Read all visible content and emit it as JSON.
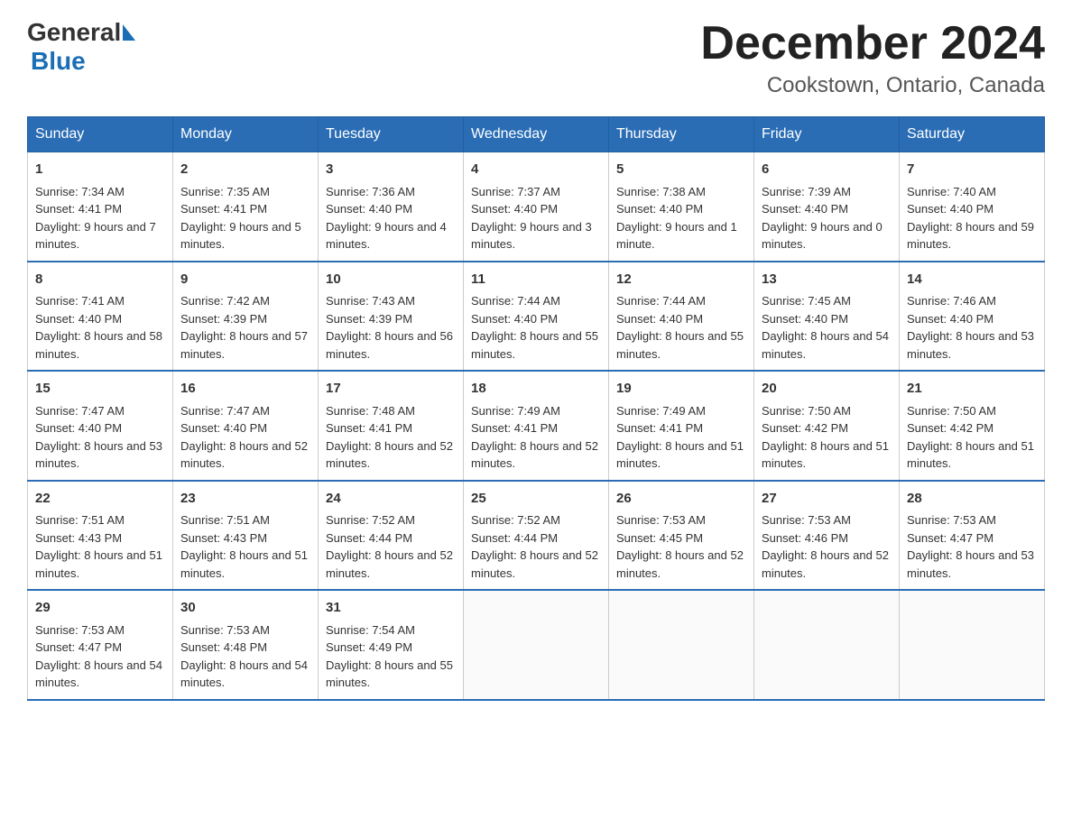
{
  "header": {
    "logo": {
      "text_general": "General",
      "text_blue": "Blue"
    },
    "month_title": "December 2024",
    "location": "Cookstown, Ontario, Canada"
  },
  "days_of_week": [
    "Sunday",
    "Monday",
    "Tuesday",
    "Wednesday",
    "Thursday",
    "Friday",
    "Saturday"
  ],
  "weeks": [
    [
      {
        "day": "1",
        "sunrise": "7:34 AM",
        "sunset": "4:41 PM",
        "daylight": "9 hours and 7 minutes."
      },
      {
        "day": "2",
        "sunrise": "7:35 AM",
        "sunset": "4:41 PM",
        "daylight": "9 hours and 5 minutes."
      },
      {
        "day": "3",
        "sunrise": "7:36 AM",
        "sunset": "4:40 PM",
        "daylight": "9 hours and 4 minutes."
      },
      {
        "day": "4",
        "sunrise": "7:37 AM",
        "sunset": "4:40 PM",
        "daylight": "9 hours and 3 minutes."
      },
      {
        "day": "5",
        "sunrise": "7:38 AM",
        "sunset": "4:40 PM",
        "daylight": "9 hours and 1 minute."
      },
      {
        "day": "6",
        "sunrise": "7:39 AM",
        "sunset": "4:40 PM",
        "daylight": "9 hours and 0 minutes."
      },
      {
        "day": "7",
        "sunrise": "7:40 AM",
        "sunset": "4:40 PM",
        "daylight": "8 hours and 59 minutes."
      }
    ],
    [
      {
        "day": "8",
        "sunrise": "7:41 AM",
        "sunset": "4:40 PM",
        "daylight": "8 hours and 58 minutes."
      },
      {
        "day": "9",
        "sunrise": "7:42 AM",
        "sunset": "4:39 PM",
        "daylight": "8 hours and 57 minutes."
      },
      {
        "day": "10",
        "sunrise": "7:43 AM",
        "sunset": "4:39 PM",
        "daylight": "8 hours and 56 minutes."
      },
      {
        "day": "11",
        "sunrise": "7:44 AM",
        "sunset": "4:40 PM",
        "daylight": "8 hours and 55 minutes."
      },
      {
        "day": "12",
        "sunrise": "7:44 AM",
        "sunset": "4:40 PM",
        "daylight": "8 hours and 55 minutes."
      },
      {
        "day": "13",
        "sunrise": "7:45 AM",
        "sunset": "4:40 PM",
        "daylight": "8 hours and 54 minutes."
      },
      {
        "day": "14",
        "sunrise": "7:46 AM",
        "sunset": "4:40 PM",
        "daylight": "8 hours and 53 minutes."
      }
    ],
    [
      {
        "day": "15",
        "sunrise": "7:47 AM",
        "sunset": "4:40 PM",
        "daylight": "8 hours and 53 minutes."
      },
      {
        "day": "16",
        "sunrise": "7:47 AM",
        "sunset": "4:40 PM",
        "daylight": "8 hours and 52 minutes."
      },
      {
        "day": "17",
        "sunrise": "7:48 AM",
        "sunset": "4:41 PM",
        "daylight": "8 hours and 52 minutes."
      },
      {
        "day": "18",
        "sunrise": "7:49 AM",
        "sunset": "4:41 PM",
        "daylight": "8 hours and 52 minutes."
      },
      {
        "day": "19",
        "sunrise": "7:49 AM",
        "sunset": "4:41 PM",
        "daylight": "8 hours and 51 minutes."
      },
      {
        "day": "20",
        "sunrise": "7:50 AM",
        "sunset": "4:42 PM",
        "daylight": "8 hours and 51 minutes."
      },
      {
        "day": "21",
        "sunrise": "7:50 AM",
        "sunset": "4:42 PM",
        "daylight": "8 hours and 51 minutes."
      }
    ],
    [
      {
        "day": "22",
        "sunrise": "7:51 AM",
        "sunset": "4:43 PM",
        "daylight": "8 hours and 51 minutes."
      },
      {
        "day": "23",
        "sunrise": "7:51 AM",
        "sunset": "4:43 PM",
        "daylight": "8 hours and 51 minutes."
      },
      {
        "day": "24",
        "sunrise": "7:52 AM",
        "sunset": "4:44 PM",
        "daylight": "8 hours and 52 minutes."
      },
      {
        "day": "25",
        "sunrise": "7:52 AM",
        "sunset": "4:44 PM",
        "daylight": "8 hours and 52 minutes."
      },
      {
        "day": "26",
        "sunrise": "7:53 AM",
        "sunset": "4:45 PM",
        "daylight": "8 hours and 52 minutes."
      },
      {
        "day": "27",
        "sunrise": "7:53 AM",
        "sunset": "4:46 PM",
        "daylight": "8 hours and 52 minutes."
      },
      {
        "day": "28",
        "sunrise": "7:53 AM",
        "sunset": "4:47 PM",
        "daylight": "8 hours and 53 minutes."
      }
    ],
    [
      {
        "day": "29",
        "sunrise": "7:53 AM",
        "sunset": "4:47 PM",
        "daylight": "8 hours and 54 minutes."
      },
      {
        "day": "30",
        "sunrise": "7:53 AM",
        "sunset": "4:48 PM",
        "daylight": "8 hours and 54 minutes."
      },
      {
        "day": "31",
        "sunrise": "7:54 AM",
        "sunset": "4:49 PM",
        "daylight": "8 hours and 55 minutes."
      },
      null,
      null,
      null,
      null
    ]
  ]
}
